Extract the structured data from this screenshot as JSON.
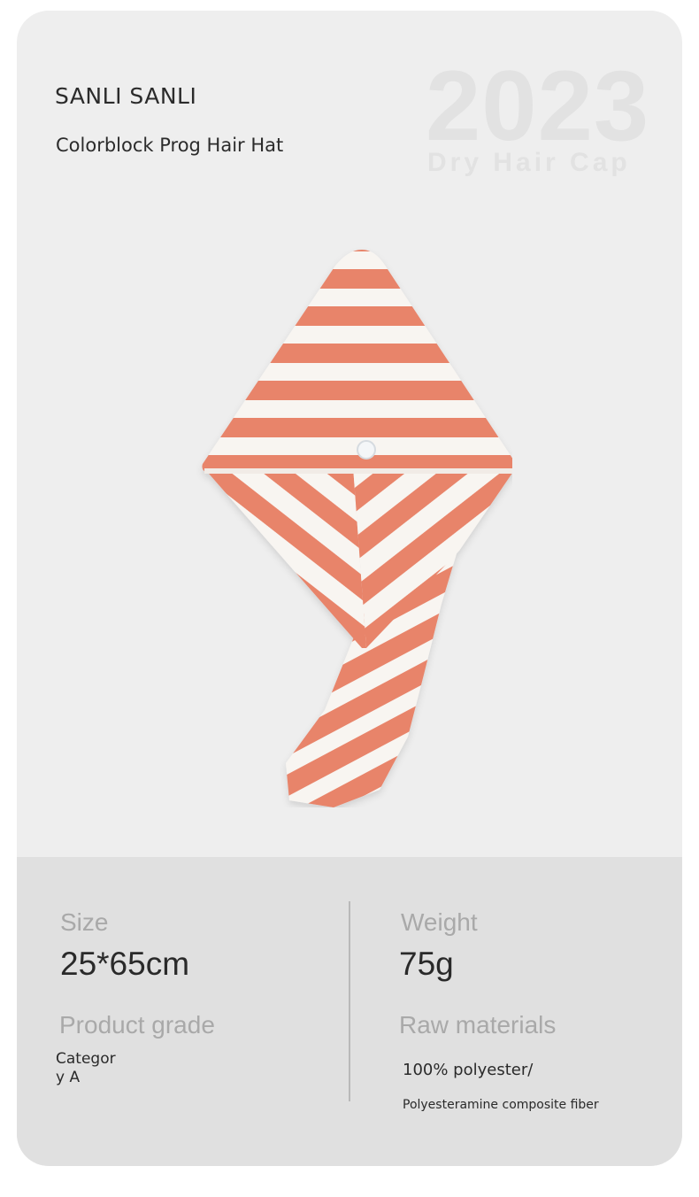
{
  "header": {
    "brand": "SANLI SANLI",
    "product_name": "Colorblock Prog Hair Hat"
  },
  "watermark": {
    "year": "2023",
    "subtitle": "Dry Hair Cap"
  },
  "product_image": {
    "icon": "striped-hair-towel-cap",
    "colors": {
      "stripe": "#e8846a",
      "base": "#f8f5f1"
    }
  },
  "specs": {
    "size_label": "Size",
    "size_value": "25*65cm",
    "weight_label": "Weight",
    "weight_value": "75g",
    "grade_label": "Product grade",
    "grade_value_line1": "Categor",
    "grade_value_line2": "y A",
    "materials_label": "Raw materials",
    "materials_value": "100% polyester/",
    "materials_note": "Polyesteramine composite fiber"
  }
}
